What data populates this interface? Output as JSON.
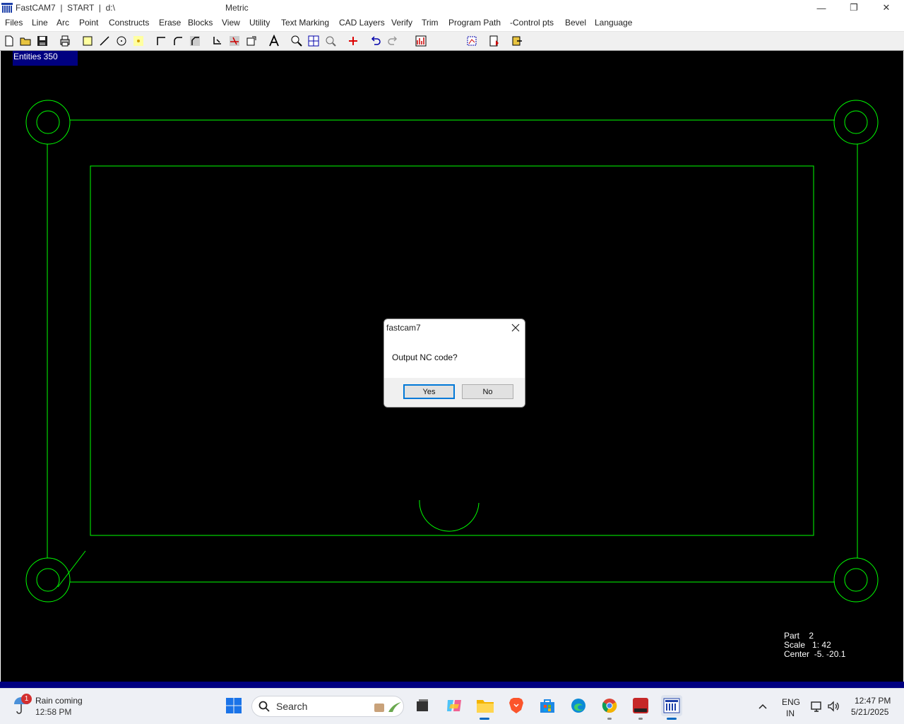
{
  "window": {
    "app_title": "FastCAM7  |  START  |  d:\\",
    "unit": "Metric",
    "minimize_glyph": "—",
    "restore_glyph": "❐",
    "close_glyph": "✕"
  },
  "menu": [
    "Files",
    "Line",
    "Arc",
    "Point",
    "Constructs",
    "Erase",
    "Blocks",
    "View",
    "Utility",
    "Text Marking",
    "CAD Layers",
    "Verify",
    "Trim",
    "Program Path",
    "-Control pts",
    "Bevel",
    "Language"
  ],
  "toolbar": {
    "icons": [
      "new-file-icon",
      "open-folder-icon",
      "save-icon",
      "print-icon",
      "rectangle-icon",
      "line-icon",
      "circle-icon",
      "point-icon",
      "corner-icon",
      "fillet-icon",
      "chamfer-icon",
      "path-icon",
      "cut-icon",
      "block-icon",
      "text-icon",
      "zoom-window-icon",
      "zoom-all-icon",
      "zoom-icon",
      "crosshair-icon",
      "undo-icon",
      "redo-icon",
      "report-icon",
      "nest-icon",
      "output-icon",
      "exit-icon"
    ]
  },
  "canvas": {
    "entities_label": "Entities  350",
    "part_label": "Part",
    "part_value": "2",
    "scale_label": "Scale",
    "scale_value": "1: 42",
    "center_label": "Center",
    "center_value": "-5. -20.1",
    "line_color": "#00ff00"
  },
  "dialog": {
    "title": "fastcam7",
    "message": "Output NC code?",
    "yes_label": "Yes",
    "no_label": "No"
  },
  "taskbar": {
    "weather_badge": "1",
    "weather_title": "Rain coming",
    "weather_time": "12:58 PM",
    "search_placeholder": "Search",
    "lang_line1": "ENG",
    "lang_line2": "IN",
    "clock_time": "12:47 PM",
    "clock_date": "5/21/2025",
    "apps": [
      "windows-start-icon",
      "search",
      "task-view-icon",
      "copilot-icon",
      "file-explorer-icon",
      "brave-icon",
      "ms-store-icon",
      "edge-icon",
      "chrome-icon",
      "solidworks-icon",
      "fastcam-icon"
    ]
  }
}
